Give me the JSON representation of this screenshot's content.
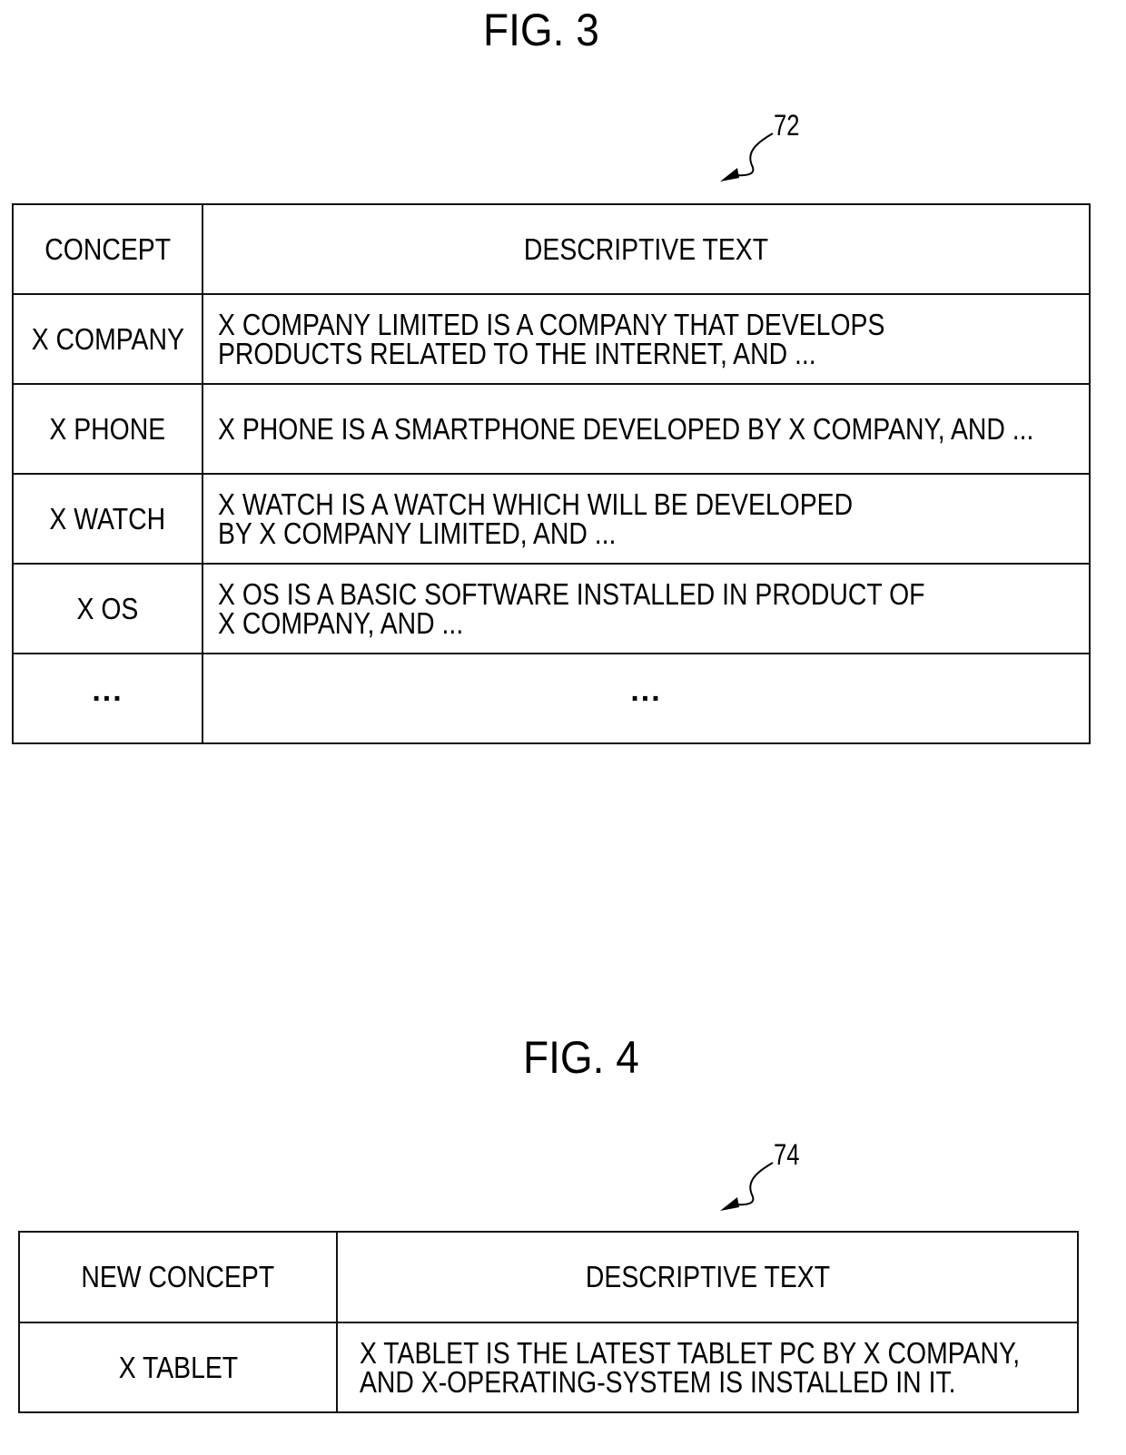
{
  "figures": [
    {
      "title": "FIG. 3",
      "reference_numeral": "72",
      "table": {
        "headers": [
          "CONCEPT",
          "DESCRIPTIVE TEXT"
        ],
        "rows": [
          {
            "concept": "X COMPANY",
            "text_lines": [
              "X COMPANY LIMITED IS A COMPANY THAT DEVELOPS",
              "PRODUCTS RELATED TO THE INTERNET, AND ..."
            ]
          },
          {
            "concept": "X PHONE",
            "text_lines": [
              "X PHONE IS A SMARTPHONE DEVELOPED BY X COMPANY, AND ..."
            ]
          },
          {
            "concept": "X WATCH",
            "text_lines": [
              "X WATCH IS A WATCH WHICH WILL BE DEVELOPED",
              "BY X COMPANY LIMITED, AND ..."
            ]
          },
          {
            "concept": "X OS",
            "text_lines": [
              "X OS IS A BASIC SOFTWARE INSTALLED IN PRODUCT OF",
              "X COMPANY, AND ..."
            ]
          },
          {
            "concept": "...",
            "text_lines": [
              "..."
            ]
          }
        ]
      }
    },
    {
      "title": "FIG. 4",
      "reference_numeral": "74",
      "table": {
        "headers": [
          "NEW CONCEPT",
          "DESCRIPTIVE TEXT"
        ],
        "rows": [
          {
            "concept": "X TABLET",
            "text_lines": [
              "X TABLET IS THE LATEST TABLET PC BY X COMPANY,",
              "AND X-OPERATING-SYSTEM IS INSTALLED IN IT."
            ]
          }
        ]
      }
    }
  ]
}
